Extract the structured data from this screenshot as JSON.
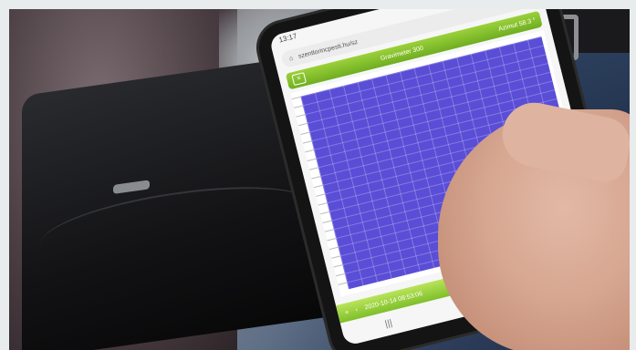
{
  "photo": {
    "description_labels": {
      "screen_url": "szentlorincpesti.hu/sz",
      "header_left": "Gravimeter 300",
      "header_right": "Azimut 58.3 °",
      "footer_timestamp": "2020-10-14 08:53:06",
      "status_time": "13:17"
    },
    "colors": {
      "grid_fill": "#5a4dd6",
      "header_green": "#7fbf2a"
    }
  }
}
